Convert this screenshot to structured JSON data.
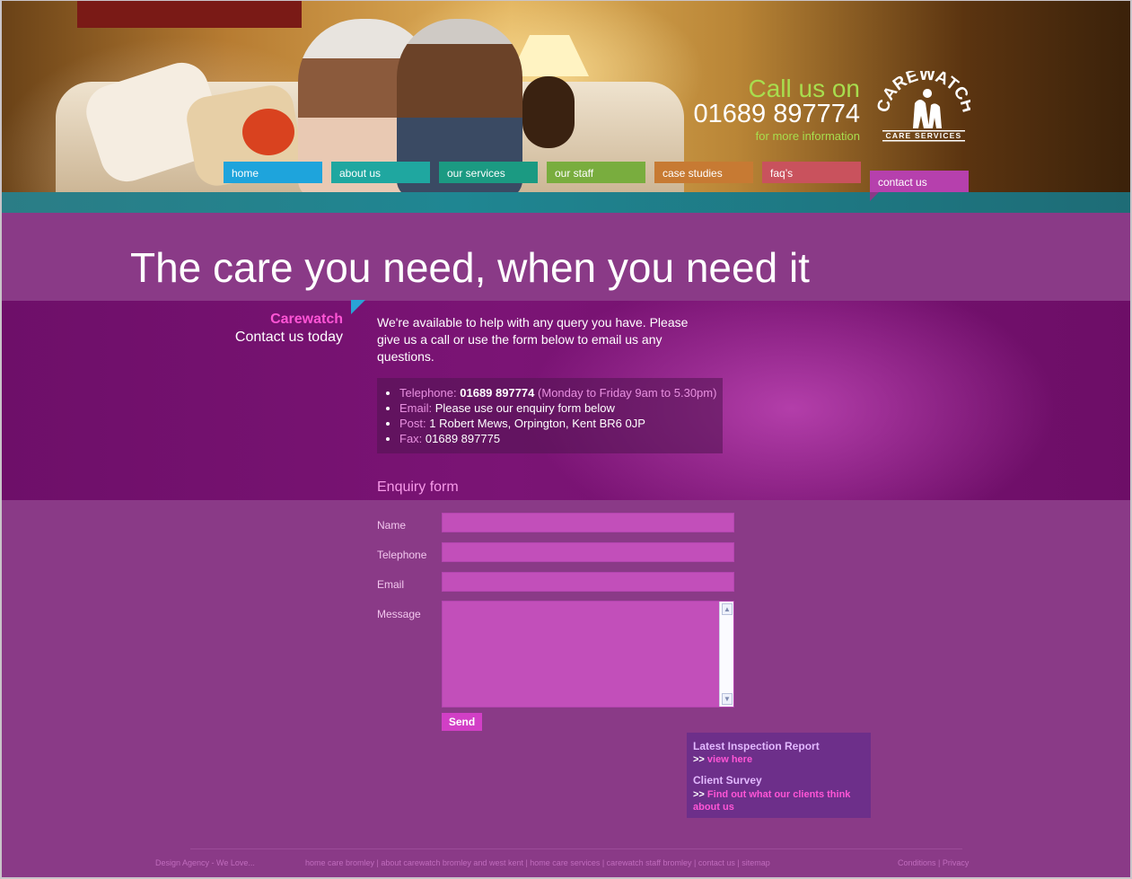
{
  "header": {
    "call_line1": "Call us on",
    "call_phone": "01689 897774",
    "call_line3": "for more information",
    "logo_text": "CAREWATCH",
    "logo_subtext": "CARE SERVICES"
  },
  "nav": {
    "items": [
      {
        "label": "home",
        "color": "#1ea4dc"
      },
      {
        "label": "about us",
        "color": "#1fa7a0"
      },
      {
        "label": "our services",
        "color": "#1b9a82"
      },
      {
        "label": "our staff",
        "color": "#79ad3e"
      },
      {
        "label": "case studies",
        "color": "#c77a33"
      },
      {
        "label": "faq’s",
        "color": "#c9525d"
      },
      {
        "label": "contact us",
        "color": "#b640ad"
      }
    ]
  },
  "hero": {
    "headline": "The care you need, when you need it"
  },
  "sidebar": {
    "brand": "Carewatch",
    "tagline": "Contact us today"
  },
  "intro": "We're available to help with any query you have. Please give us a call or use the form below to email us any questions.",
  "contact": {
    "telephone_label": "Telephone:",
    "telephone_value": "01689 897774",
    "telephone_hours": "(Monday to Friday 9am to 5.30pm)",
    "email_label": "Email:",
    "email_value": "Please use our enquiry form below",
    "post_label": "Post:",
    "post_value": "1 Robert Mews, Orpington, Kent BR6 0JP",
    "fax_label": "Fax:",
    "fax_value": "01689 897775"
  },
  "form": {
    "title": "Enquiry form",
    "name_label": "Name",
    "name_value": "",
    "telephone_label": "Telephone",
    "telephone_value": "",
    "email_label": "Email",
    "email_value": "",
    "message_label": "Message",
    "message_value": "",
    "send_label": "Send"
  },
  "side_box": {
    "inspection_title": "Latest Inspection Report",
    "inspection_prefix": ">>",
    "inspection_link": "view here",
    "survey_title": "Client Survey",
    "survey_prefix": ">>",
    "survey_link": "Find out what our clients think about us"
  },
  "footer": {
    "agency": "Design Agency - We Love...",
    "links": "home care bromley | about carewatch bromley and west kent | home care services | carewatch staff bromley | contact us | sitemap",
    "legal": "Conditions | Privacy"
  }
}
